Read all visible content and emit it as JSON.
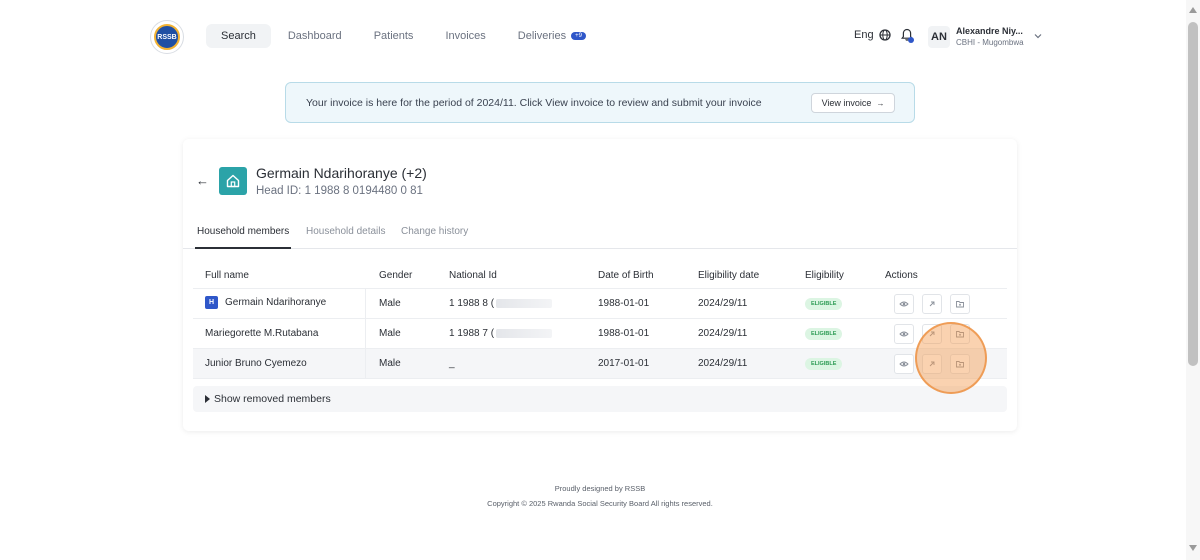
{
  "logo": {
    "text": "RSSB"
  },
  "nav": {
    "items": [
      {
        "label": "Search",
        "active": true
      },
      {
        "label": "Dashboard"
      },
      {
        "label": "Patients"
      },
      {
        "label": "Invoices"
      },
      {
        "label": "Deliveries",
        "badge": "+9"
      }
    ]
  },
  "header": {
    "language": "Eng",
    "user_initials": "AN",
    "user_name": "Alexandre Niy...",
    "user_org": "CBHI - Mugombwa"
  },
  "banner": {
    "text": "Your invoice is here for the period of 2024/11. Click View invoice to review and submit your invoice",
    "button_label": "View invoice",
    "button_arrow": "→"
  },
  "household": {
    "back_arrow": "←",
    "name": "Germain Ndarihoranye (+2)",
    "head_id": "Head ID: 1 1988 8 0194480 0 81"
  },
  "tabs": [
    {
      "label": "Household members",
      "active": true
    },
    {
      "label": "Household details"
    },
    {
      "label": "Change history"
    }
  ],
  "table": {
    "columns": [
      "Full name",
      "Gender",
      "National Id",
      "Date of Birth",
      "Eligibility date",
      "Eligibility",
      "Actions"
    ],
    "rows": [
      {
        "head_badge": "H",
        "full_name": "Germain Ndarihoranye",
        "gender": "Male",
        "national_id": "1 1988 8 (",
        "dob": "1988-01-01",
        "eligibility_date": "2024/29/11",
        "eligibility": "ELIGIBLE"
      },
      {
        "full_name": "Mariegorette M.Rutabana",
        "gender": "Male",
        "national_id": "1 1988 7 (",
        "dob": "1988-01-01",
        "eligibility_date": "2024/29/11",
        "eligibility": "ELIGIBLE"
      },
      {
        "full_name": "Junior Bruno Cyemezo",
        "gender": "Male",
        "national_id": "_",
        "dob": "2017-01-01",
        "eligibility_date": "2024/29/11",
        "eligibility": "ELIGIBLE"
      }
    ]
  },
  "removed_members": {
    "label": "Show removed members"
  },
  "footer": {
    "line1": "Proudly designed by RSSB",
    "line2": "Copyright © 2025 Rwanda Social Security Board All rights reserved."
  },
  "icons": {
    "view": "eye-icon",
    "transfer": "arrow-up-right-icon",
    "folder": "folder-icon",
    "home": "home-icon",
    "bell": "bell-icon",
    "globe": "globe-icon"
  },
  "colors": {
    "brand_teal": "#2ba3a8",
    "accent_blue": "#2f57c9",
    "eligible_green": "#2e9b55",
    "click_highlight": "#f39c4f"
  }
}
